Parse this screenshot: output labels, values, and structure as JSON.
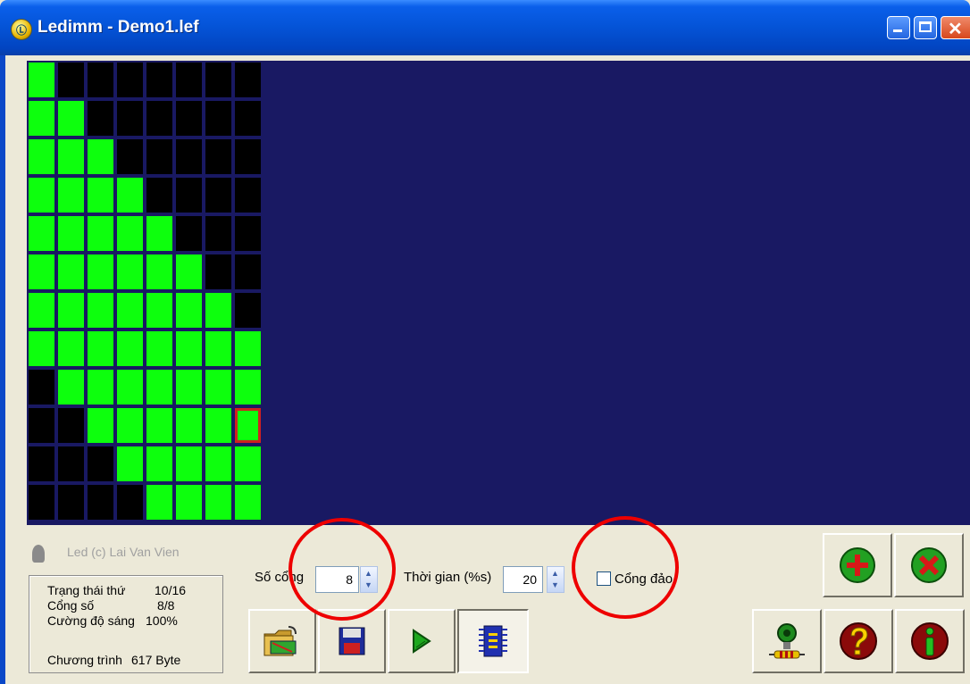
{
  "window": {
    "title": "Ledimm - Demo1.lef"
  },
  "led_matrix": {
    "rows": [
      "10000000",
      "11000000",
      "11100000",
      "11110000",
      "11111000",
      "11111100",
      "11111110",
      "11111111",
      "01111111",
      "00111111",
      "00011111",
      "00001111"
    ],
    "selected": {
      "row": 9,
      "col": 7
    },
    "colors": {
      "on": "#0DFF0D",
      "off": "#000000",
      "background": "#191963",
      "selected_border": "#D02020"
    }
  },
  "credit": "Led (c) Lai Van Vien",
  "status": {
    "frame_label": "Trạng thái thứ",
    "frame_value": "10/16",
    "ports_label": "Cổng số",
    "ports_value": "8/8",
    "brightness_label": "Cường độ sáng",
    "brightness_value": "100%",
    "program_label": "Chương trình",
    "program_value": "617 Byte"
  },
  "controls": {
    "ports_label": "Số cổng",
    "ports_value": "8",
    "time_label": "Thời gian (%s)",
    "time_value": "20",
    "invert_label": "Cổng đảo",
    "invert_checked": false
  },
  "highlight_color": "#EE0000",
  "buttons": [
    {
      "name": "open-button",
      "icon": "folder-open-icon"
    },
    {
      "name": "save-button",
      "icon": "floppy-disk-icon"
    },
    {
      "name": "play-button",
      "icon": "play-icon"
    },
    {
      "name": "chip-button",
      "icon": "chip-icon"
    },
    {
      "name": "add-button",
      "icon": "plus-icon"
    },
    {
      "name": "delete-button",
      "icon": "x-icon"
    },
    {
      "name": "hardware-button",
      "icon": "lamp-resistor-icon"
    },
    {
      "name": "help-button",
      "icon": "question-icon"
    },
    {
      "name": "info-button",
      "icon": "info-icon"
    }
  ]
}
